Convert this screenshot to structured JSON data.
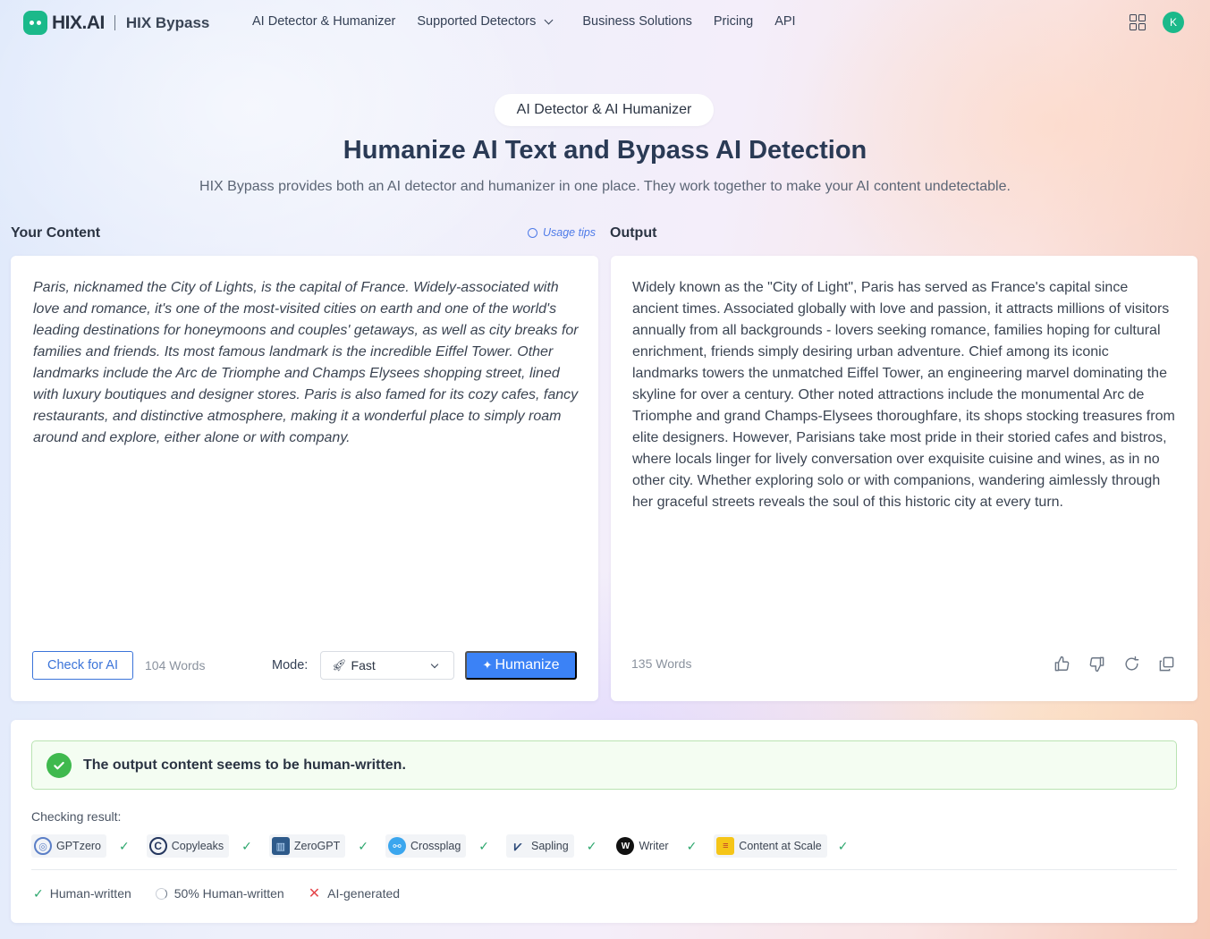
{
  "brand": {
    "logo_text": "HIX.AI",
    "product": "HIX Bypass",
    "accent": "#1bb98a"
  },
  "nav": {
    "items": [
      {
        "label": "AI Detector & Humanizer"
      },
      {
        "label": "Supported Detectors",
        "has_dropdown": true
      },
      {
        "label": "Business Solutions"
      },
      {
        "label": "Pricing"
      },
      {
        "label": "API"
      }
    ],
    "apps_icon": "grid-icon",
    "avatar_letter": "K"
  },
  "hero": {
    "pill": "AI Detector & AI Humanizer",
    "title": "Humanize AI Text and Bypass AI Detection",
    "subtitle": "HIX Bypass provides both an AI detector and humanizer in one place. They work together to make your AI content undetectable."
  },
  "input_panel": {
    "label": "Your Content",
    "usage_tips": "Usage tips",
    "text": "Paris, nicknamed the City of Lights, is the capital of France. Widely-associated with love and romance, it's one of the most-visited cities on earth and one of the world's leading destinations for honeymoons and couples' getaways, as well as city breaks for families and friends. Its most famous landmark is the incredible Eiffel Tower. Other landmarks include the Arc de Triomphe and Champs Elysees shopping street, lined with luxury boutiques and designer stores. Paris is also famed for its cozy cafes, fancy restaurants, and distinctive atmosphere, making it a wonderful place to simply roam around and explore, either alone or with company.",
    "check_button": "Check for AI",
    "word_count": "104 Words",
    "mode_label": "Mode:",
    "mode_value": "Fast",
    "humanize_button": "Humanize",
    "primary_color": "#3b82f6"
  },
  "output_panel": {
    "label": "Output",
    "text": "Widely known as the \"City of Light\", Paris has served as France's capital since ancient times. Associated globally with love and passion, it attracts millions of visitors annually from all backgrounds - lovers seeking romance, families hoping for cultural enrichment, friends simply desiring urban adventure. Chief among its iconic landmarks towers the unmatched Eiffel Tower, an engineering marvel dominating the skyline for over a century. Other noted attractions include the monumental Arc de Triomphe and grand Champs-Elysees thoroughfare, its shops stocking treasures from elite designers. However, Parisians take most pride in their storied cafes and bistros, where locals linger for lively conversation over exquisite cuisine and wines, as in no other city. Whether exploring solo or with companions, wandering aimlessly through her graceful streets reveals the soul of this historic city at every turn.",
    "word_count": "135 Words",
    "actions": [
      "thumbs-up-icon",
      "thumbs-down-icon",
      "regenerate-icon",
      "copy-icon"
    ]
  },
  "results": {
    "banner": "The output content seems to be human-written.",
    "checking_label": "Checking result:",
    "detectors": [
      {
        "name": "GPTzero",
        "status": "human"
      },
      {
        "name": "Copyleaks",
        "status": "human"
      },
      {
        "name": "ZeroGPT",
        "status": "human"
      },
      {
        "name": "Crossplag",
        "status": "human"
      },
      {
        "name": "Sapling",
        "status": "human"
      },
      {
        "name": "Writer",
        "status": "human"
      },
      {
        "name": "Content at Scale",
        "status": "human"
      }
    ],
    "legend": {
      "human": "Human-written",
      "half": "50% Human-written",
      "ai": "AI-generated"
    },
    "success_color": "#3fb94e"
  }
}
